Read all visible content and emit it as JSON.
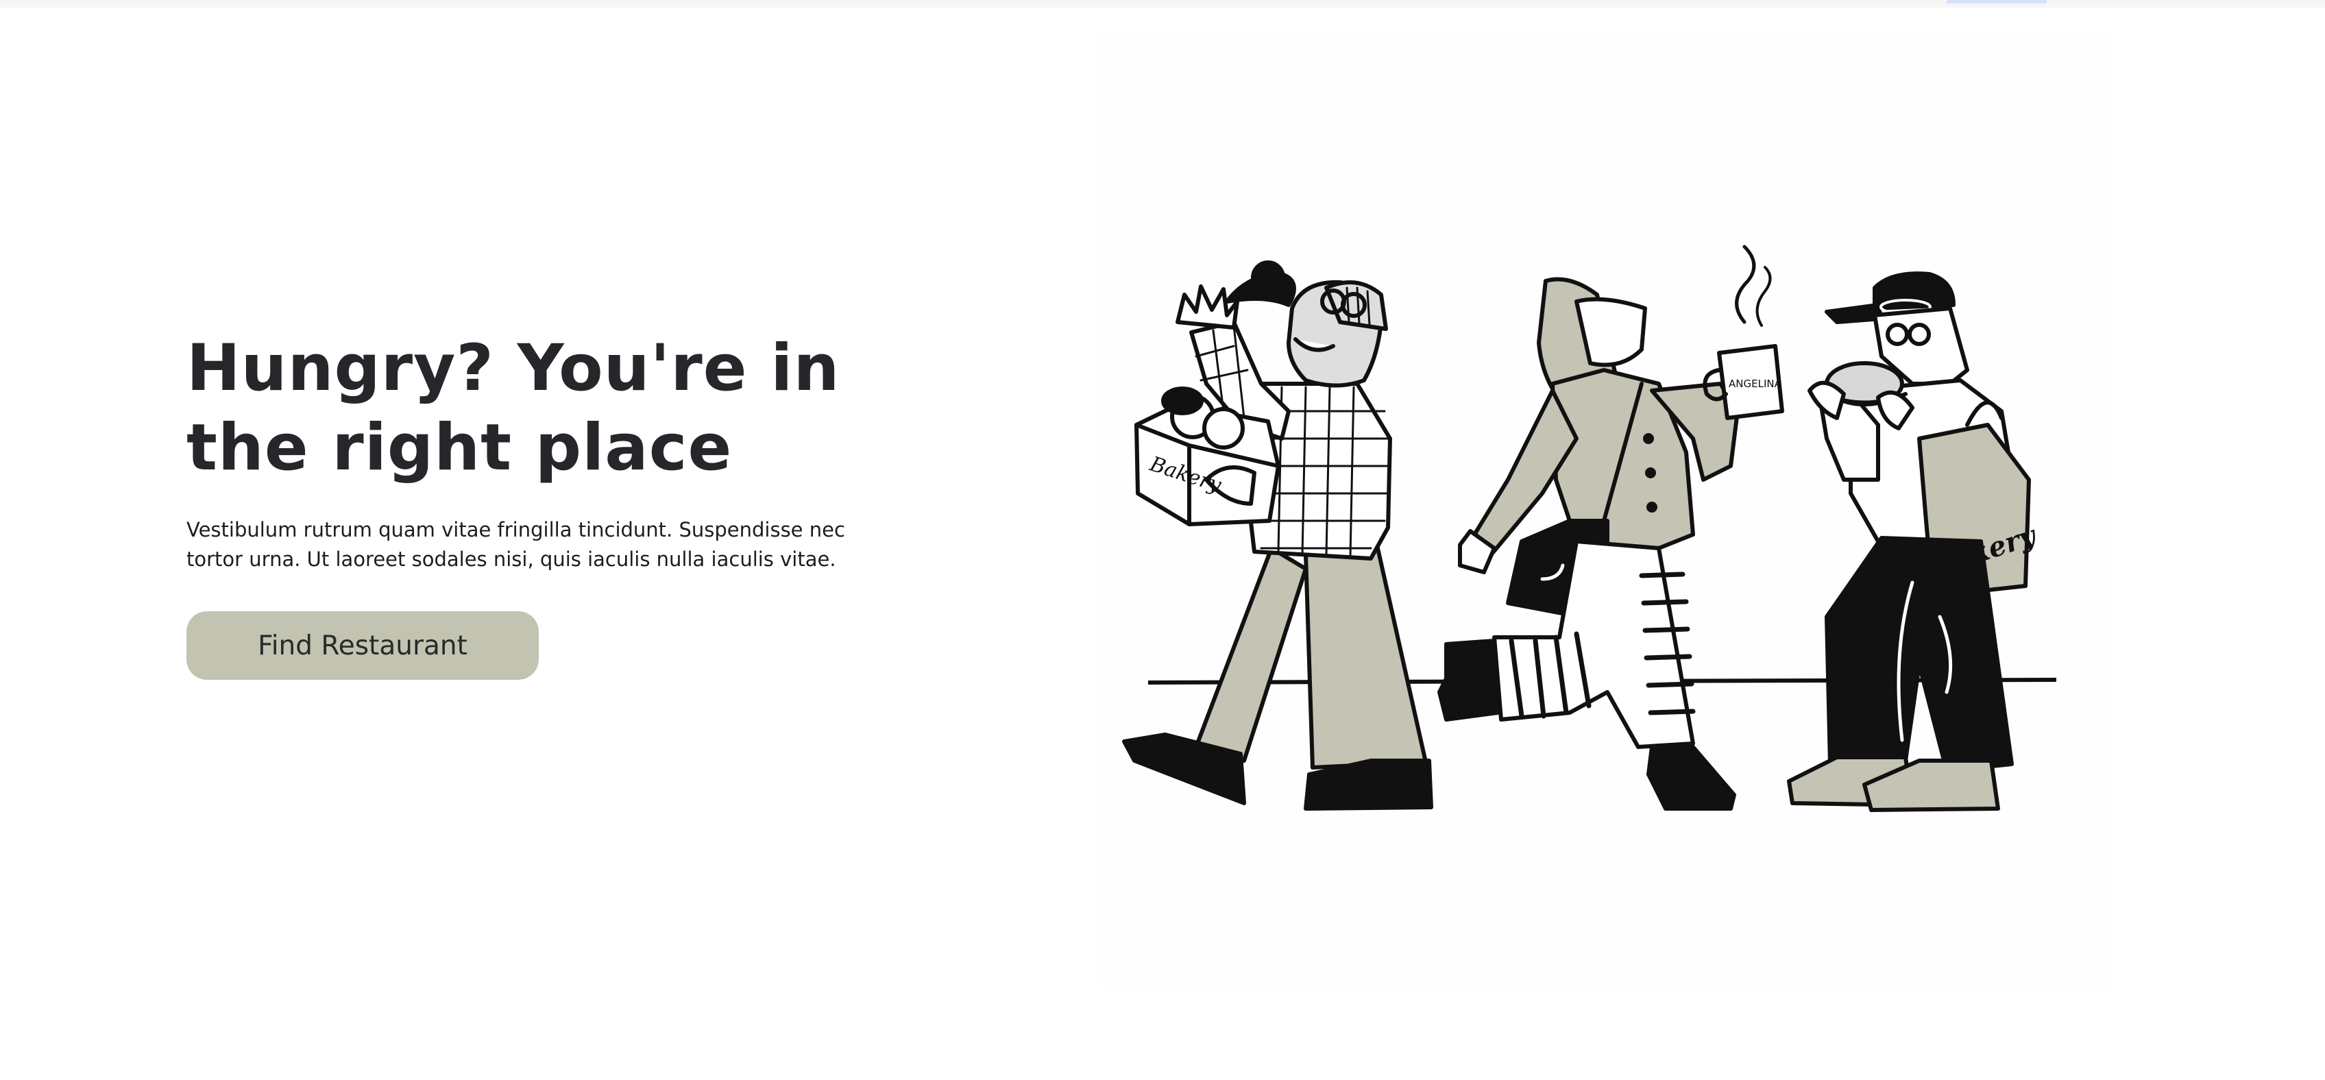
{
  "hero": {
    "title_line1": "Hungry? You're in",
    "title_line2": "the right place",
    "description": "Vestibulum rutrum quam vitae fringilla tincidunt. Suspendisse nec tortor urna. Ut laoreet sodales nisi, quis iaculis nulla iaculis vitae.",
    "cta_label": "Find Restaurant"
  },
  "illustration": {
    "box_lettering": "Bakery",
    "mug_lettering": "ANGELINA",
    "bag_lettering": "Bakery"
  },
  "colors": {
    "title": "#26272b",
    "button_bg": "#c2c3b1",
    "khaki": "#c4c3b4",
    "ink": "#111111"
  }
}
